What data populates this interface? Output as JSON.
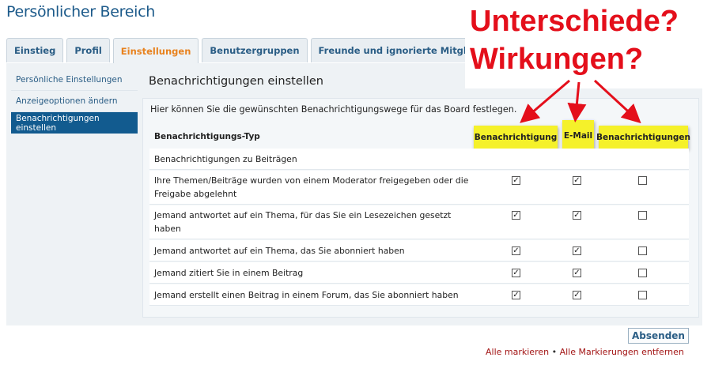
{
  "page_title": "Persönlicher Bereich",
  "tabs": [
    {
      "label": "Einstieg",
      "active": false
    },
    {
      "label": "Profil",
      "active": false
    },
    {
      "label": "Einstellungen",
      "active": true
    },
    {
      "label": "Benutzergruppen",
      "active": false
    },
    {
      "label": "Freunde und ignorierte Mitglieder",
      "active": false
    }
  ],
  "sidebar": {
    "items": [
      {
        "label": "Persönliche Einstellungen",
        "active": false
      },
      {
        "label": "Anzeigeoptionen ändern",
        "active": false
      },
      {
        "label": "Benachrichtigungen einstellen",
        "active": true
      }
    ]
  },
  "content": {
    "heading": "Benachrichtigungen einstellen",
    "intro": "Hier können Sie die gewünschten Benachrichtigungswege für das Board festlegen.",
    "table": {
      "type_header": "Benachrichtigungs-Typ",
      "columns": [
        "Benachrichtigung",
        "E-Mail",
        "Benachrichtigungen"
      ],
      "section_label": "Benachrichtigungen zu Beiträgen",
      "rows": [
        {
          "label": "Ihre Themen/Beiträge wurden von einem Moderator freigegeben oder die Freigabe abgelehnt",
          "checks": [
            true,
            true,
            false
          ]
        },
        {
          "label": "Jemand antwortet auf ein Thema, für das Sie ein Lesezeichen gesetzt haben",
          "checks": [
            true,
            true,
            false
          ]
        },
        {
          "label": "Jemand antwortet auf ein Thema, das Sie abonniert haben",
          "checks": [
            true,
            true,
            false
          ]
        },
        {
          "label": "Jemand zitiert Sie in einem Beitrag",
          "checks": [
            true,
            true,
            false
          ]
        },
        {
          "label": "Jemand erstellt einen Beitrag in einem Forum, das Sie abonniert haben",
          "checks": [
            true,
            true,
            false
          ]
        }
      ]
    }
  },
  "annotation": {
    "line1": "Unterschiede?",
    "line2": "Wirkungen?",
    "color": "#e40f1b"
  },
  "actions": {
    "submit_label": "Absenden",
    "mark_all": "Alle markieren",
    "separator": "•",
    "unmark_all": "Alle Markierungen entfernen"
  },
  "colors": {
    "accent": "#125b8f",
    "active_tab": "#e8821e",
    "highlight": "#f5f12a",
    "link_red": "#a31515"
  }
}
